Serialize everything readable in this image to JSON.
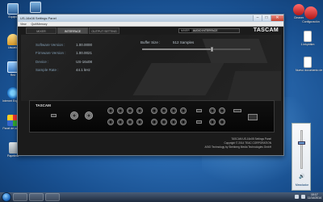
{
  "desktop": {
    "icons_left": [
      {
        "label": "Equipo",
        "icon": "computer-icon"
      },
      {
        "label": "Usuario",
        "icon": "user-folder-icon"
      },
      {
        "label": "Red",
        "icon": "network-icon"
      },
      {
        "label": "Internet Explorer",
        "icon": "ie-icon"
      },
      {
        "label": "Panel de control",
        "icon": "control-panel-icon"
      },
      {
        "label": "Papelera",
        "icon": "recycle-bin-icon"
      }
    ],
    "icons_right": [
      {
        "label": "Cleaner",
        "icon": "cleaner-icon"
      },
      {
        "label": "Configuración",
        "icon": "config-icon"
      },
      {
        "label": "1.lnkpbtkm",
        "icon": "document-icon"
      },
      {
        "label": "Nuevo documento de texto",
        "icon": "document-icon"
      }
    ],
    "top_icon": {
      "label": "Driver Setup",
      "icon": "setup-icon"
    }
  },
  "app": {
    "title": "US-16x08 Settings Panel",
    "menu": [
      "View",
      "Quit/Memory"
    ],
    "tabs": [
      {
        "label": "MIXER",
        "active": false
      },
      {
        "label": "INTERFACE",
        "active": true
      },
      {
        "label": "OUTPUT SETTING",
        "active": false
      }
    ],
    "model_label": "MIXER",
    "model_value": "AUDIO INTERFACE",
    "brand": "TASCAM",
    "url": "http://tascam.com/",
    "info": [
      {
        "key": "Software Version :",
        "value": "1.00.0000"
      },
      {
        "key": "Firmware Version :",
        "value": "1.00.0021"
      },
      {
        "key": "Device :",
        "value": "US-16x08"
      },
      {
        "key": "Sample Rate :",
        "value": "44.1 kHz"
      }
    ],
    "buffer_label": "Buffer Size :",
    "buffer_value": "512 Samples",
    "buffer_level": 0.65,
    "device_brand": "TASCAM",
    "footer_lines": [
      "TASCAM US-16x08 Settings Panel",
      "Copyright © 2014 TEAC CORPORATION",
      "ASIO Technology by Steinberg Media Technologies GmbH"
    ]
  },
  "volume": {
    "label": "Mezclador",
    "level": 0.7
  },
  "taskbar": {
    "time": "10:17",
    "date": "11/14/2014"
  }
}
